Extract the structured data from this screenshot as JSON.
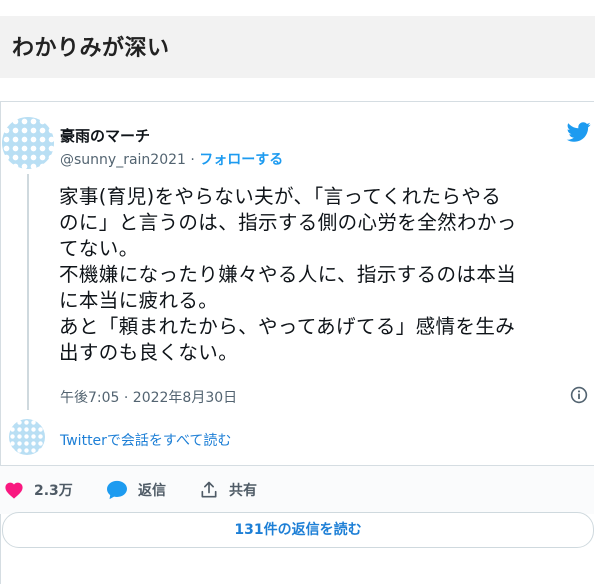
{
  "header": {
    "title": "わかりみが深い"
  },
  "tweet": {
    "author_name": "豪雨のマーチ",
    "handle": "@sunny_rain2021",
    "separator": "·",
    "follow_label": "フォローする",
    "text": "家事(育児)をやらない夫が、「言ってくれたらやる\nのに」と言うのは、指示する側の心労を全然わかっ\nてない。\n不機嫌になったり嫌々やる人に、指示するのは本当\nに本当に疲れる。\nあと「頼まれたから、やってあげてる」感情を生み\n出すのも良くない。",
    "timestamp": "午後7:05 · 2022年8月30日",
    "conversation_link": "Twitterで会話をすべて読む"
  },
  "actions": {
    "likes": "2.3万",
    "reply_label": "返信",
    "share_label": "共有"
  },
  "read_replies_label": "131件の返信を読む",
  "colors": {
    "accent": "#1d9bf0",
    "like": "#f91880",
    "avatar": "#b9dff4"
  },
  "icons": [
    "twitter-bird-icon",
    "info-icon",
    "heart-icon",
    "reply-bubble-icon",
    "share-icon"
  ]
}
